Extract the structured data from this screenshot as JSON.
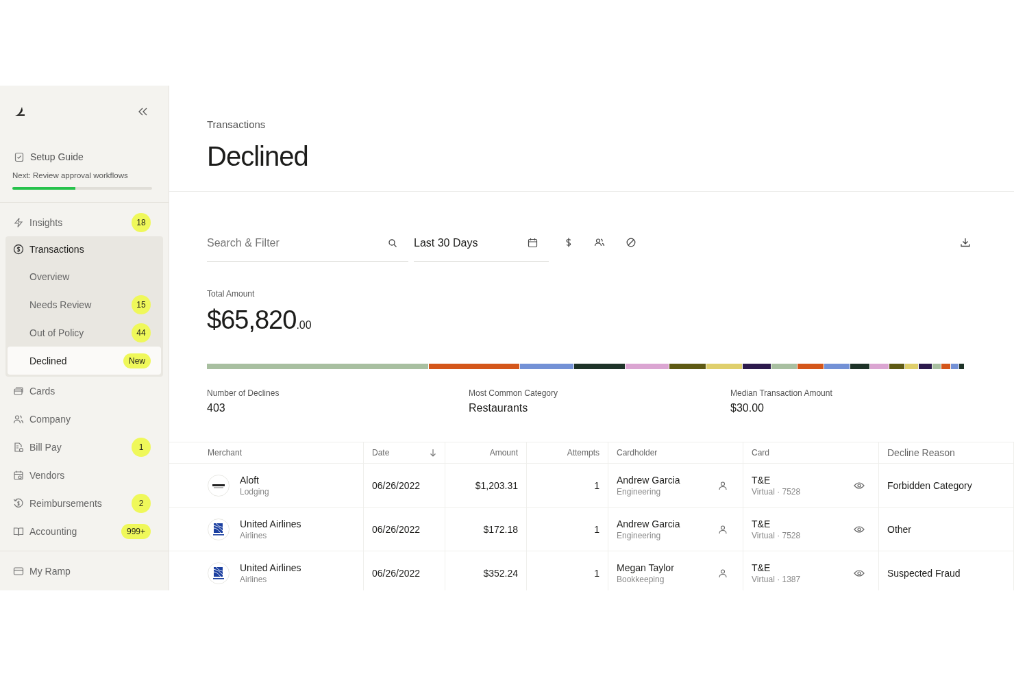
{
  "sidebar": {
    "setup_guide": {
      "label": "Setup Guide",
      "next": "Next: Review approval workflows",
      "level": 0.45
    },
    "groups": [
      {
        "items": [
          {
            "label": "Insights",
            "badge": "18",
            "selected": false
          },
          {
            "label": "Transactions",
            "selected": false,
            "expanded": true,
            "children": [
              {
                "label": "Overview",
                "selected": false
              },
              {
                "label": "Needs Review",
                "badge": "15",
                "selected": false
              },
              {
                "label": "Out of Policy",
                "badge": "44",
                "selected": false
              },
              {
                "label": "Declined",
                "badge": "New",
                "selected": true
              }
            ]
          },
          {
            "label": "Cards",
            "selected": false
          },
          {
            "label": "Company",
            "selected": false
          },
          {
            "label": "Bill Pay",
            "badge": "1",
            "selected": false
          },
          {
            "label": "Vendors",
            "selected": false
          },
          {
            "label": "Reimbursements",
            "badge": "2",
            "selected": false
          },
          {
            "label": "Accounting",
            "badge": "999+",
            "selected": false
          }
        ]
      },
      {
        "items": [
          {
            "label": "My Ramp",
            "selected": false
          }
        ]
      }
    ]
  },
  "header": {
    "breadcrumb": "Transactions",
    "title": "Declined"
  },
  "toolbar": {
    "search": {
      "placeholder": "Search & Filter"
    },
    "date": {
      "value": "Last 30 Days"
    }
  },
  "total": {
    "label": "Total Amount",
    "whole": "$65,820",
    "cents": ".00"
  },
  "breakdown": [
    {
      "color": "#a8bfa0"
    },
    {
      "color": "#d4561a"
    },
    {
      "color": "#7391d6"
    },
    {
      "color": "#1e3328"
    },
    {
      "color": "#dba5d2"
    },
    {
      "color": "#5e5a14"
    },
    {
      "color": "#dfcf6c"
    },
    {
      "color": "#2c1a4c"
    },
    {
      "color": "#a8bfa0"
    },
    {
      "color": "#d4561a"
    },
    {
      "color": "#7391d6"
    },
    {
      "color": "#1e3328"
    },
    {
      "color": "#dba5d2"
    },
    {
      "color": "#5e5a14"
    },
    {
      "color": "#dfcf6c"
    },
    {
      "color": "#2c1a4c"
    },
    {
      "color": "#a8bfa0"
    },
    {
      "color": "#d4561a"
    },
    {
      "color": "#7391d6"
    },
    {
      "color": "#1e3328"
    }
  ],
  "stats": [
    {
      "label": "Number of Declines",
      "value": "403"
    },
    {
      "label": "Most Common Category",
      "value": "Restaurants"
    },
    {
      "label": "Median Transaction Amount",
      "value": "$30.00"
    }
  ],
  "table": {
    "columns": [
      {
        "label": "Merchant",
        "sorted": false
      },
      {
        "label": "Date",
        "sorted": true
      },
      {
        "label": "Amount",
        "sorted": false
      },
      {
        "label": "Attempts",
        "sorted": false
      },
      {
        "label": "Cardholder",
        "sorted": false
      },
      {
        "label": "Card",
        "sorted": false
      },
      {
        "label": "Decline Reason",
        "sorted": false
      }
    ],
    "rows": [
      {
        "merchant": "Aloft",
        "category": "Lodging",
        "kind": "hotel",
        "date": "06/26/2022",
        "amount": "$1,203.31",
        "attempts": "1",
        "cardholder": "Andrew Garcia",
        "department": "Engineering",
        "card": "T&E",
        "card_detail": "Virtual · 7528",
        "reason": "Forbidden Category"
      },
      {
        "merchant": "United Airlines",
        "category": "Airlines",
        "kind": "airline",
        "date": "06/26/2022",
        "amount": "$172.18",
        "attempts": "1",
        "cardholder": "Andrew Garcia",
        "department": "Engineering",
        "card": "T&E",
        "card_detail": "Virtual · 7528",
        "reason": "Other"
      },
      {
        "merchant": "United Airlines",
        "category": "Airlines",
        "kind": "airline",
        "date": "06/26/2022",
        "amount": "$352.24",
        "attempts": "1",
        "cardholder": "Megan Taylor",
        "department": "Bookkeeping",
        "card": "T&E",
        "card_detail": "Virtual · 1387",
        "reason": "Suspected Fraud"
      }
    ]
  }
}
